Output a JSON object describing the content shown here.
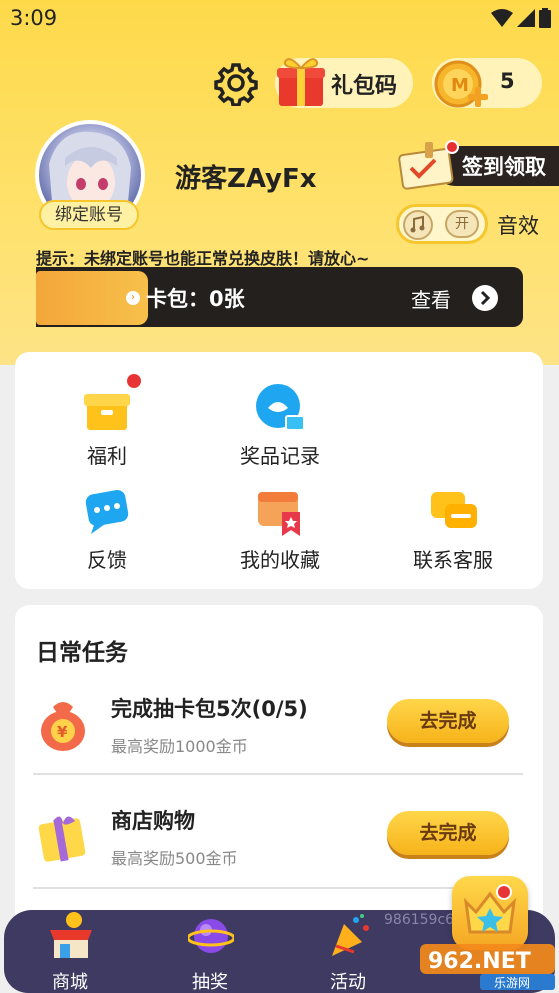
{
  "status_bar": {
    "time": "3:09"
  },
  "header": {
    "gift_code_label": "礼包码",
    "coin_count": "5"
  },
  "profile": {
    "username": "游客ZAyFx",
    "bind_label": "绑定账号",
    "signin_label": "签到领取",
    "sound_label": "音效",
    "sound_toggle_text": "开",
    "tip": "提示：未绑定账号也能正常兑换皮肤！请放心~"
  },
  "card_pack": {
    "label": "卡包：0张",
    "view_label": "查看"
  },
  "menu": {
    "items": [
      {
        "label": "福利",
        "icon": "gift-box-icon"
      },
      {
        "label": "奖品记录",
        "icon": "prize-record-icon"
      },
      {
        "label": "反馈",
        "icon": "feedback-icon"
      },
      {
        "label": "我的收藏",
        "icon": "favorites-icon"
      },
      {
        "label": "联系客服",
        "icon": "customer-service-icon"
      }
    ]
  },
  "daily_tasks": {
    "title": "日常任务",
    "tasks": [
      {
        "name": "完成抽卡包5次(0/5)",
        "reward": "最高奖励1000金币",
        "button": "去完成",
        "icon": "money-bag-icon"
      },
      {
        "name": "商店购物",
        "reward": "最高奖励500金币",
        "button": "去完成",
        "icon": "gift-box-icon"
      }
    ]
  },
  "tabbar": {
    "tabs": [
      {
        "label": "商城",
        "icon": "shop-icon"
      },
      {
        "label": "抽奖",
        "icon": "planet-icon"
      },
      {
        "label": "活动",
        "icon": "party-popper-icon"
      }
    ],
    "watermark": "986159c6",
    "logo_text": "962.NET",
    "logo_sub": "乐游网"
  },
  "colors": {
    "header_yellow": "#fdd94a",
    "dark_bar": "#23201e",
    "tabbar": "#3f3a62",
    "button_gold": "#f6b31a"
  }
}
